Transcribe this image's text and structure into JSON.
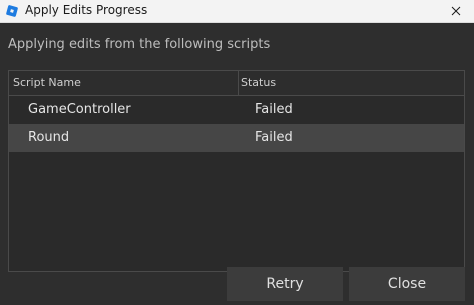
{
  "window": {
    "title": "Apply Edits Progress",
    "icon": "roblox-studio-icon",
    "close_icon": "close-icon"
  },
  "dialog": {
    "heading": "Applying edits from the following scripts"
  },
  "table": {
    "columns": [
      "Script Name",
      "Status"
    ],
    "rows": [
      {
        "name": "GameController",
        "status": "Failed"
      },
      {
        "name": "Round",
        "status": "Failed"
      }
    ],
    "selected_row": 1
  },
  "buttons": {
    "retry": "Retry",
    "close": "Close"
  },
  "colors": {
    "background": "#2e2e2e",
    "titlebar": "#f3f3f3",
    "selected_row": "#464646",
    "button": "#3c3c3c",
    "text": "#e6e6e6",
    "accent": "#1d7be0"
  }
}
